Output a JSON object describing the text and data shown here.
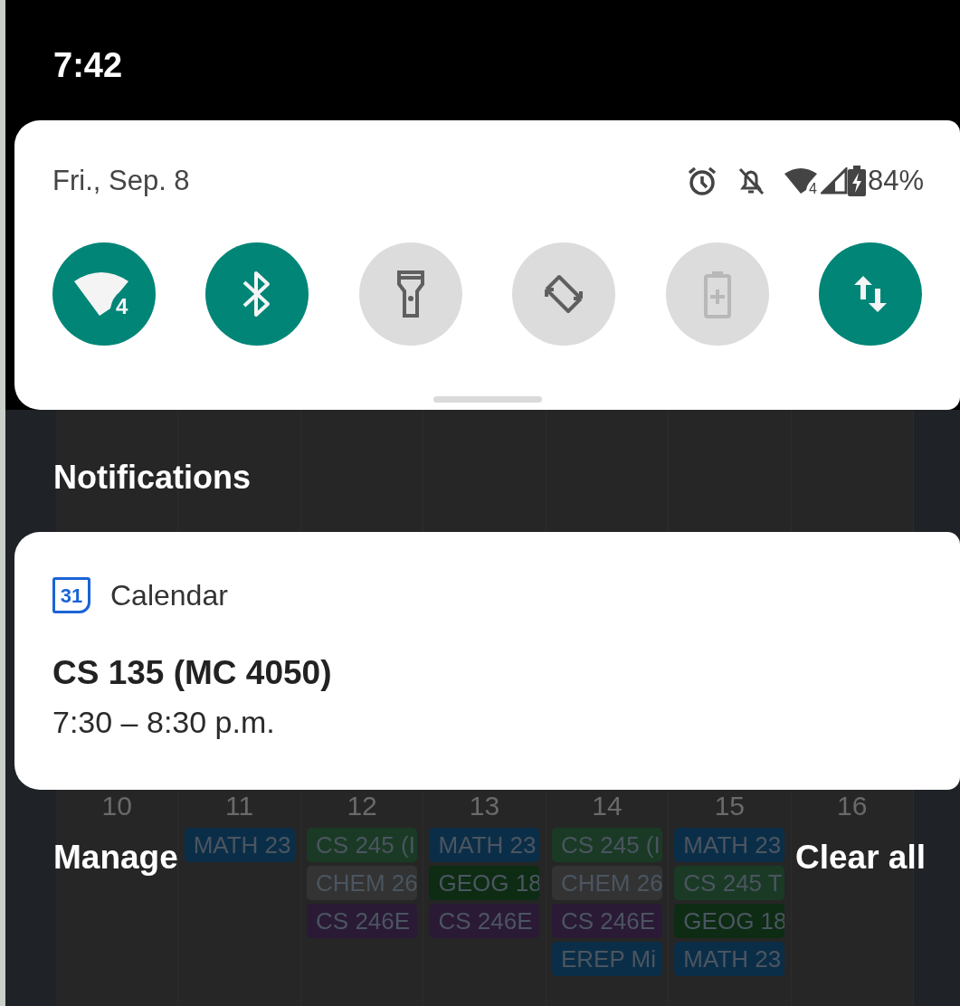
{
  "status_bar": {
    "time": "7:42"
  },
  "quick_settings": {
    "date": "Fri., Sep. 8",
    "network_badge": "4",
    "battery": "84%",
    "tiles": [
      {
        "kind": "wifi",
        "on": true,
        "disabled": false,
        "badge": "4"
      },
      {
        "kind": "bluetooth",
        "on": true,
        "disabled": false
      },
      {
        "kind": "flashlight",
        "on": false,
        "disabled": false
      },
      {
        "kind": "rotate",
        "on": false,
        "disabled": false
      },
      {
        "kind": "battery_saver",
        "on": false,
        "disabled": true
      },
      {
        "kind": "data",
        "on": true,
        "disabled": false
      }
    ]
  },
  "notifications": {
    "header": "Notifications",
    "items": [
      {
        "app": "Calendar",
        "app_icon_text": "31",
        "title": "CS 135 (MC 4050)",
        "text": "7:30 – 8:30 p.m."
      }
    ],
    "actions": [
      "Manage",
      "Clear all"
    ]
  },
  "background_calendar": {
    "days": [
      "10",
      "11",
      "12",
      "13",
      "14",
      "15",
      "16"
    ],
    "columns": [
      [],
      [
        {
          "label": "MATH 23",
          "color": "#0b2e48"
        }
      ],
      [
        {
          "label": "CS 245 (I",
          "color": "#1a3a25"
        },
        {
          "label": "CHEM 26",
          "color": "#333333"
        },
        {
          "label": "CS 246E",
          "color": "#2a1a36"
        }
      ],
      [
        {
          "label": "MATH 23",
          "color": "#0b2e48"
        },
        {
          "label": "GEOG 18",
          "color": "#0d2c13"
        },
        {
          "label": "CS 246E",
          "color": "#2a1a36"
        }
      ],
      [
        {
          "label": "CS 245 (I",
          "color": "#1a3a25"
        },
        {
          "label": "CHEM 26",
          "color": "#333333"
        },
        {
          "label": "CS 246E",
          "color": "#2a1a36"
        },
        {
          "label": "EREP Mi",
          "color": "#0b2e48"
        }
      ],
      [
        {
          "label": "MATH 23",
          "color": "#0b2e48"
        },
        {
          "label": "CS 245 T",
          "color": "#1a3a25"
        },
        {
          "label": "GEOG 18",
          "color": "#0d2c13"
        },
        {
          "label": "MATH 23",
          "color": "#0b2e48"
        }
      ],
      []
    ]
  }
}
